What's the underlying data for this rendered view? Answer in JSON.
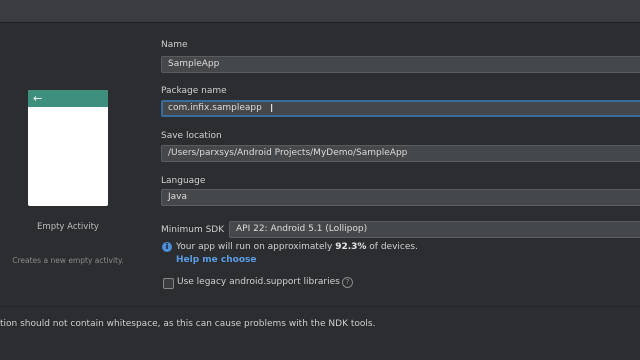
{
  "template": {
    "name": "Empty Activity",
    "description": "Creates a new empty activity.",
    "back_icon": "arrow-left-icon"
  },
  "form": {
    "name_label": "Name",
    "name_value": "SampleApp",
    "package_label": "Package name",
    "package_value": "com.infix.sampleapp",
    "save_label": "Save location",
    "save_value": "/Users/parxsys/Android Projects/MyDemo/SampleApp",
    "language_label": "Language",
    "language_value": "Java",
    "sdk_label": "Minimum SDK",
    "sdk_value": "API 22: Android 5.1 (Lollipop)"
  },
  "info": {
    "icon": "info-icon",
    "text_prefix": "Your app will run on approximately ",
    "percent": "92.3%",
    "text_suffix": " of devices.",
    "help_link": "Help me choose"
  },
  "legacy": {
    "checkbox_label": "Use legacy android.support libraries",
    "checked": false,
    "help_icon": "question-icon"
  },
  "warning_text": "tion should not contain whitespace, as this can cause problems with the NDK tools.",
  "colors": {
    "accent": "#3f8f7f",
    "link": "#5a9de6",
    "focus": "#3b6c9e"
  }
}
